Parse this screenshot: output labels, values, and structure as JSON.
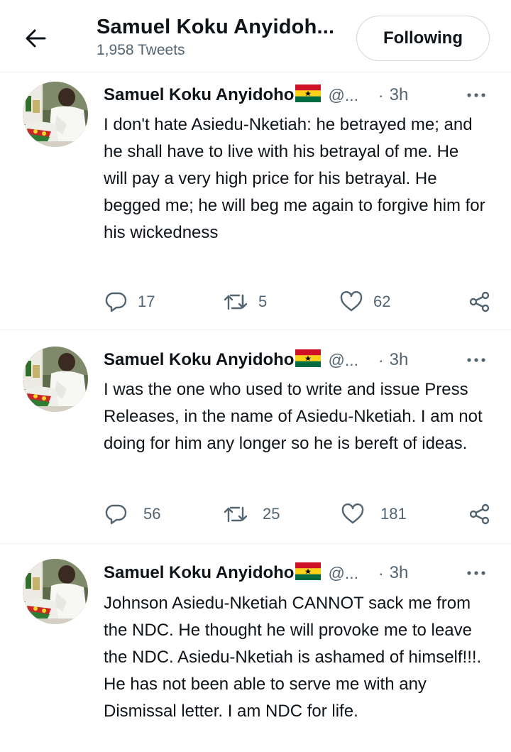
{
  "header": {
    "title": "Samuel Koku Anyidoh...",
    "subtitle": "1,958 Tweets",
    "follow_label": "Following"
  },
  "colors": {
    "text": "#0f1419",
    "secondary": "#536471",
    "divider": "#eff3f4",
    "flag_red": "#ce1126",
    "flag_gold": "#fcd116",
    "flag_green": "#006b3f"
  },
  "icons": [
    "back-arrow-icon",
    "ghana-flag-icon",
    "more-icon",
    "reply-icon",
    "retweet-icon",
    "like-icon",
    "share-icon"
  ],
  "tweets": [
    {
      "name": "Samuel Koku Anyidoho",
      "handle": "@...",
      "separator": "·",
      "time": "3h",
      "text": "I don't hate Asiedu-Nketiah: he betrayed me; and he shall have to live with his betrayal of me.  He will pay a very high price for his betrayal.  He begged me; he will beg me again to forgive him for his wickedness",
      "replies": "17",
      "retweets": "5",
      "likes": "62"
    },
    {
      "name": "Samuel Koku Anyidoho",
      "handle": "@...",
      "separator": "·",
      "time": "3h",
      "text": "I was the one who used to write and issue Press Releases, in the name of Asiedu-Nketiah. I am not doing for him any longer so he is bereft of ideas.",
      "replies": "56",
      "retweets": "25",
      "likes": "181"
    },
    {
      "name": "Samuel Koku Anyidoho",
      "handle": "@...",
      "separator": "·",
      "time": "3h",
      "text": "Johnson Asiedu-Nketiah CANNOT  sack me from the NDC. He thought he will provoke me to leave the NDC.   Asiedu-Nketiah is ashamed of himself!!!.  He has not been able to serve me with any Dismissal letter. I am NDC for life."
    }
  ]
}
